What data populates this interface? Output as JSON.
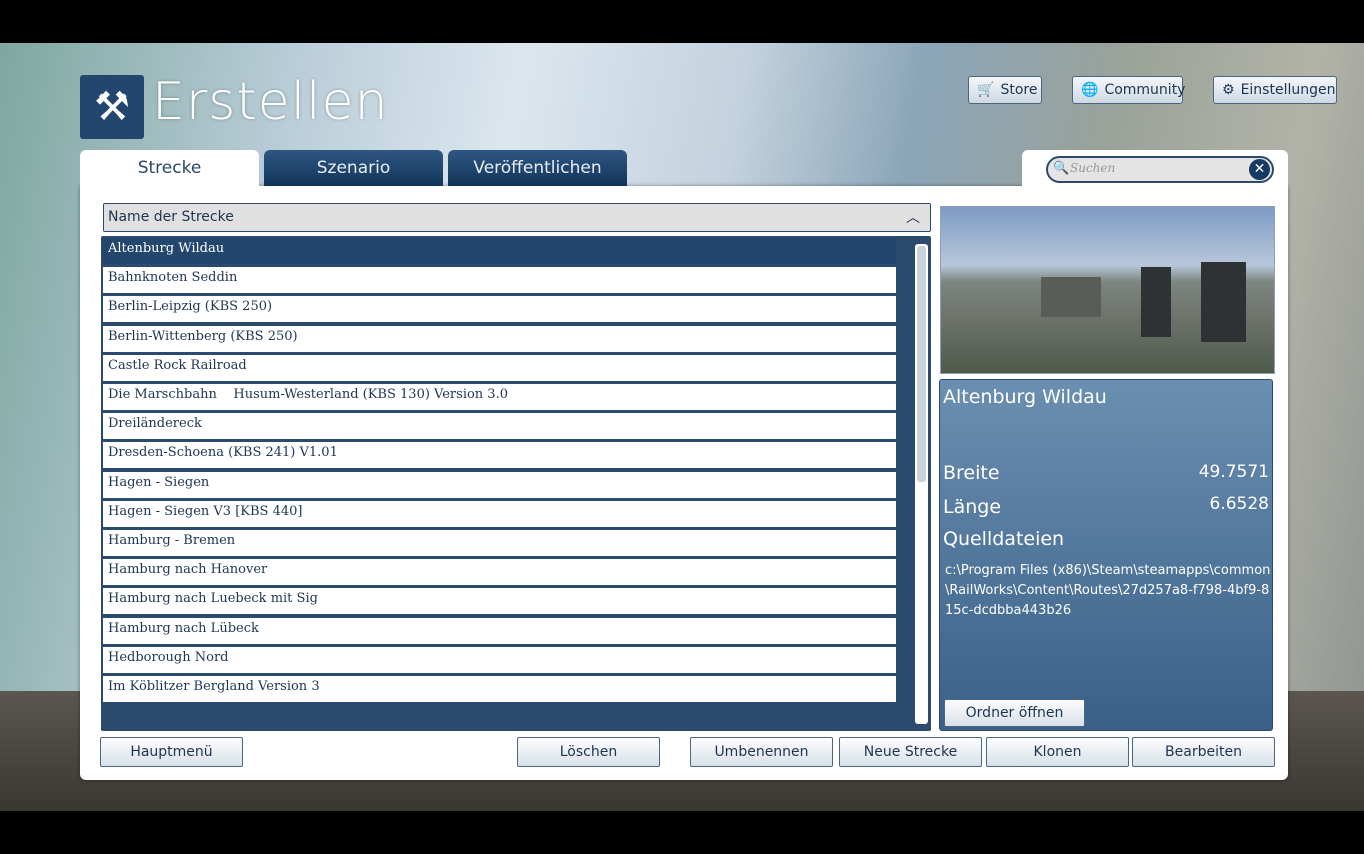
{
  "header": {
    "title": "Erstellen",
    "store": "Store",
    "community": "Community",
    "settings": "Einstellungen"
  },
  "tabs": [
    "Strecke",
    "Szenario",
    "Veröffentlichen"
  ],
  "search": {
    "placeholder": "Suchen"
  },
  "list": {
    "header": "Name der Strecke",
    "items": [
      "Altenburg Wildau",
      "Bahnknoten Seddin",
      "Berlin-Leipzig (KBS 250)",
      "Berlin-Wittenberg (KBS 250)",
      "Castle Rock Railroad",
      "Die Marschbahn    Husum-Westerland (KBS 130) Version 3.0",
      "Dreiländereck",
      "Dresden-Schoena (KBS 241) V1.01",
      "Hagen - Siegen",
      "Hagen - Siegen V3 [KBS 440]",
      "Hamburg - Bremen",
      "Hamburg nach Hanover",
      "Hamburg nach Luebeck mit Sig",
      "Hamburg nach Lübeck",
      "Hedborough Nord",
      "Im Köblitzer Bergland Version 3"
    ],
    "selected": 0
  },
  "details": {
    "name": "Altenburg Wildau",
    "lat_label": "Breite",
    "lat": "49.7571",
    "lon_label": "Länge",
    "lon": "6.6528",
    "src_label": "Quelldateien",
    "path": "c:\\Program Files (x86)\\Steam\\steamapps\\common\\RailWorks\\Content\\Routes\\27d257a8-f798-4bf9-815c-dcdbba443b26",
    "open_folder": "Ordner öffnen"
  },
  "buttons": {
    "main_menu": "Hauptmenü",
    "delete": "Löschen",
    "rename": "Umbenennen",
    "new": "Neue Strecke",
    "clone": "Klonen",
    "edit": "Bearbeiten"
  }
}
